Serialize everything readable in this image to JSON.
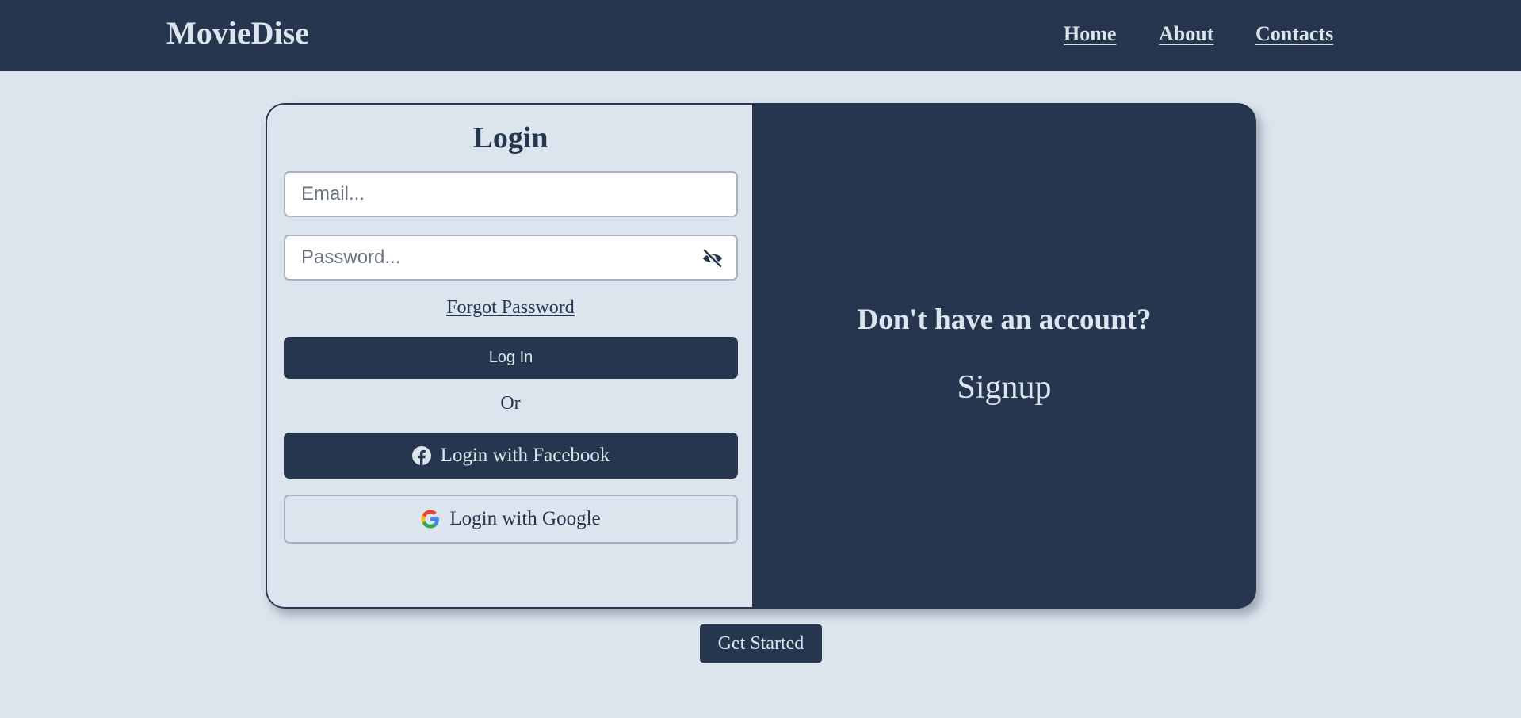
{
  "navbar": {
    "brand": "MovieDise",
    "links": [
      {
        "label": "Home"
      },
      {
        "label": "About"
      },
      {
        "label": "Contacts"
      }
    ]
  },
  "login": {
    "title": "Login",
    "email_placeholder": "Email...",
    "email_value": "",
    "password_placeholder": "Password...",
    "password_value": "",
    "password_toggle_icon": "eye-slash-icon",
    "forgot_password": "Forgot Password",
    "login_button": "Log In",
    "or_text": "Or",
    "facebook_button": "Login with Facebook",
    "facebook_icon": "facebook-icon",
    "google_button": "Login with Google",
    "google_icon": "google-icon"
  },
  "signup_panel": {
    "prompt": "Don't have an account?",
    "signup_link": "Signup"
  },
  "get_started_button": "Get Started",
  "colors": {
    "primary": "#26364e",
    "background": "#dce5ed",
    "input_border": "#a3b3c2"
  }
}
